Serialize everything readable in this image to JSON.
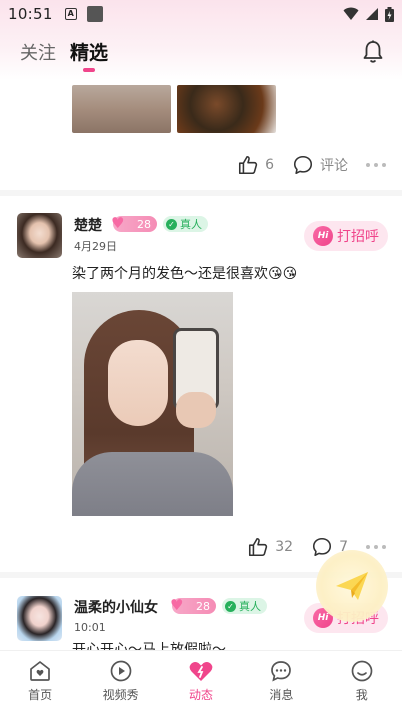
{
  "status_bar": {
    "time": "10:51",
    "a_icon": "A"
  },
  "tabs": [
    {
      "label": "关注",
      "active": false
    },
    {
      "label": "精选",
      "active": true
    }
  ],
  "accent_color": "#f0458b",
  "prev_post": {
    "likes": "6",
    "comment_label": "评论"
  },
  "posts": [
    {
      "username": "楚楚",
      "level": "28",
      "verified_label": "真人",
      "date": "4月29日",
      "greet_label": "打招呼",
      "greet_hi": "Hi",
      "content": "染了两个月的发色～还是很喜欢😘😘",
      "likes": "32",
      "comments": "7"
    },
    {
      "username": "温柔的小仙女",
      "level": "28",
      "verified_label": "真人",
      "date": "10:01",
      "greet_label": "打招呼",
      "greet_hi": "Hi",
      "content": "开心开心～马上放假啦～"
    }
  ],
  "bottom_nav": [
    {
      "label": "首页",
      "icon": "home-heart-icon",
      "active": false
    },
    {
      "label": "视频秀",
      "icon": "play-icon",
      "active": false
    },
    {
      "label": "动态",
      "icon": "heart-icon",
      "active": true
    },
    {
      "label": "消息",
      "icon": "chat-icon",
      "active": false
    },
    {
      "label": "我",
      "icon": "smile-icon",
      "active": false
    }
  ]
}
